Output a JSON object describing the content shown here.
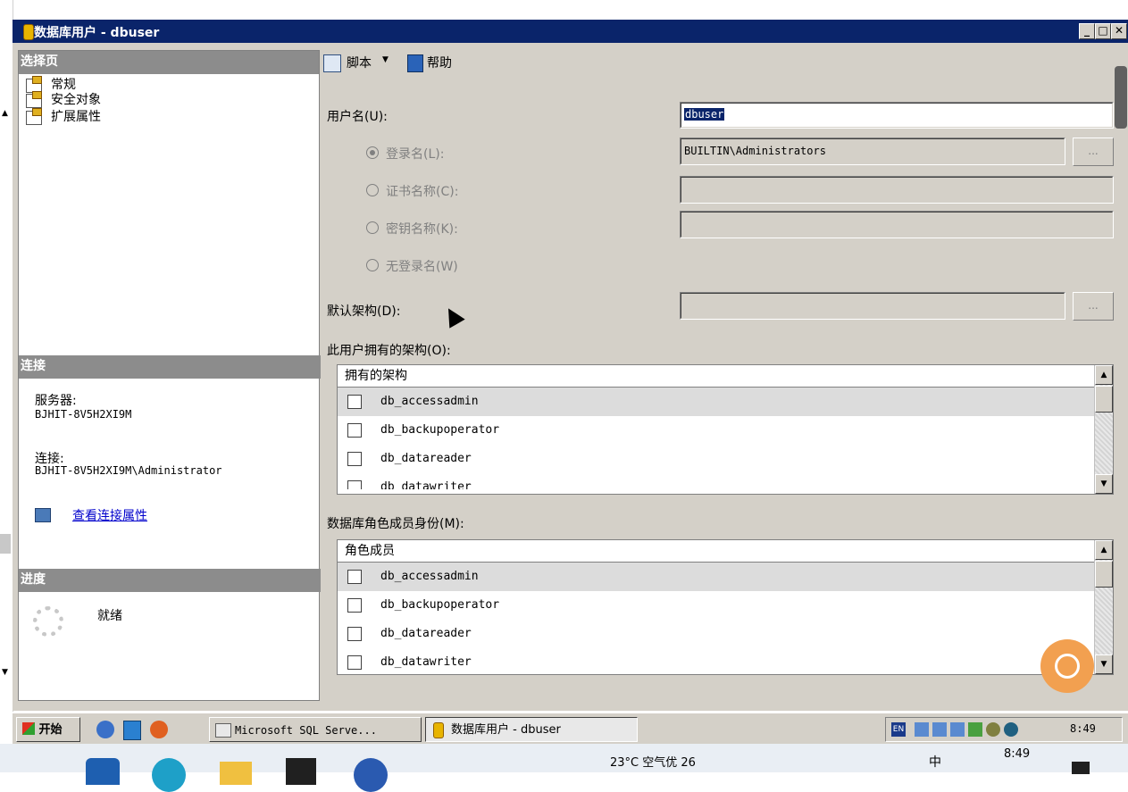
{
  "window": {
    "title": "数据库用户 - dbuser",
    "controls": [
      "_",
      "□",
      "✕"
    ]
  },
  "left_panel": {
    "select_page_header": "选择页",
    "pages": [
      {
        "label": "常规"
      },
      {
        "label": "安全对象"
      },
      {
        "label": "扩展属性"
      }
    ],
    "connection_header": "连接",
    "server_label": "服务器:",
    "server_value": "BJHIT-8V5H2XI9M",
    "connection_label": "连接:",
    "connection_value": "BJHIT-8V5H2XI9M\\Administrator",
    "view_connection_link": "查看连接属性",
    "progress_header": "进度",
    "progress_status": "就绪"
  },
  "toolbar": {
    "script_label": "脚本",
    "help_label": "帮助"
  },
  "form": {
    "username_label": "用户名(U):",
    "username_value": "dbuser",
    "login_name_label": "登录名(L):",
    "login_name_value": "BUILTIN\\Administrators",
    "cert_name_label": "证书名称(C):",
    "key_name_label": "密钥名称(K):",
    "no_login_label": "无登录名(W)",
    "default_schema_label": "默认架构(D):",
    "browse_label": "...",
    "owned_schemas_label": "此用户拥有的架构(O):",
    "owned_schemas_header": "拥有的架构",
    "owned_schemas": [
      "db_accessadmin",
      "db_backupoperator",
      "db_datareader",
      "db_datawriter"
    ],
    "role_members_label": "数据库角色成员身份(M):",
    "role_members_header": "角色成员",
    "role_members": [
      "db_accessadmin",
      "db_backupoperator",
      "db_datareader",
      "db_datawriter"
    ]
  },
  "xp_taskbar": {
    "start_label": "开始",
    "task1": "Microsoft SQL Serve...",
    "task2": "数据库用户 - dbuser",
    "ime": "EN",
    "clock": "8:49"
  },
  "win_taskbar": {
    "weather": "23°C 空气优 26",
    "ime": "中",
    "clock": "8:49"
  }
}
